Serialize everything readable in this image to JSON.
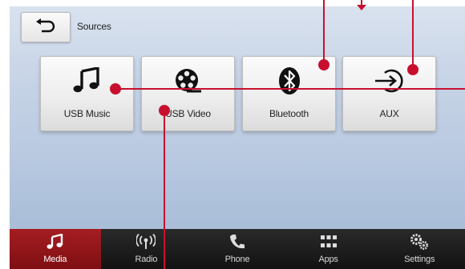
{
  "header": {
    "title": "Sources"
  },
  "sources": [
    {
      "label": "USB Music",
      "icon": "music-note-icon"
    },
    {
      "label": "USB Video",
      "icon": "film-reel-icon"
    },
    {
      "label": "Bluetooth",
      "icon": "bluetooth-icon"
    },
    {
      "label": "AUX",
      "icon": "aux-input-icon"
    }
  ],
  "nav": [
    {
      "label": "Media",
      "icon": "music-note-icon",
      "active": true
    },
    {
      "label": "Radio",
      "icon": "radio-signal-icon",
      "active": false
    },
    {
      "label": "Phone",
      "icon": "phone-icon",
      "active": false
    },
    {
      "label": "Apps",
      "icon": "apps-grid-icon",
      "active": false
    },
    {
      "label": "Settings",
      "icon": "gears-icon",
      "active": false
    }
  ],
  "colors": {
    "callout": "#c8102e",
    "active_tab": "#a51d21",
    "screen_top": "#d9e2ef",
    "screen_bottom": "#a9bdd8"
  }
}
